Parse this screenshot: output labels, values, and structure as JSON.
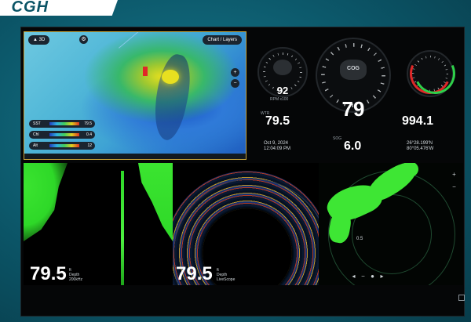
{
  "brand": {
    "logo_text": "CGH"
  },
  "chart": {
    "mode_label": "▲ 3D",
    "top_right_label": "Chart / Layers",
    "legend": [
      {
        "label": "SST",
        "value": "79.5"
      },
      {
        "label": "Chl",
        "value": "0.4"
      },
      {
        "label": "Alt",
        "value": "12"
      }
    ]
  },
  "instruments": {
    "left_gauge": {
      "value": "92",
      "caption": "RPM x100"
    },
    "center_gauge": {
      "inner_label": "COG",
      "value": "79"
    },
    "right_gauge": {},
    "water_temp": {
      "label": "WTR",
      "value": "79.5"
    },
    "speed": {
      "label": "SOG",
      "value": "6.0"
    },
    "pressure": {
      "value": "994.1"
    },
    "date_time": {
      "date": "Oct 9, 2024",
      "time": "12:04:09 PM"
    },
    "position": {
      "lat": "26°28.199'N",
      "lon": "80°05.476'W"
    }
  },
  "sonar_left": {
    "depth": "79.5",
    "unit": "ft",
    "sub1": "Depth",
    "sub2": "200kHz"
  },
  "sonar_mid": {
    "depth": "79.5",
    "unit": "ft",
    "sub1": "Depth",
    "sub2": "LiveScope"
  },
  "radar": {
    "range_label": "0.5",
    "zoom_in": "+",
    "zoom_out": "−"
  },
  "colors": {
    "accent": "#3ee634",
    "frame": "#c9a43a",
    "bezel": "#0b5466"
  }
}
